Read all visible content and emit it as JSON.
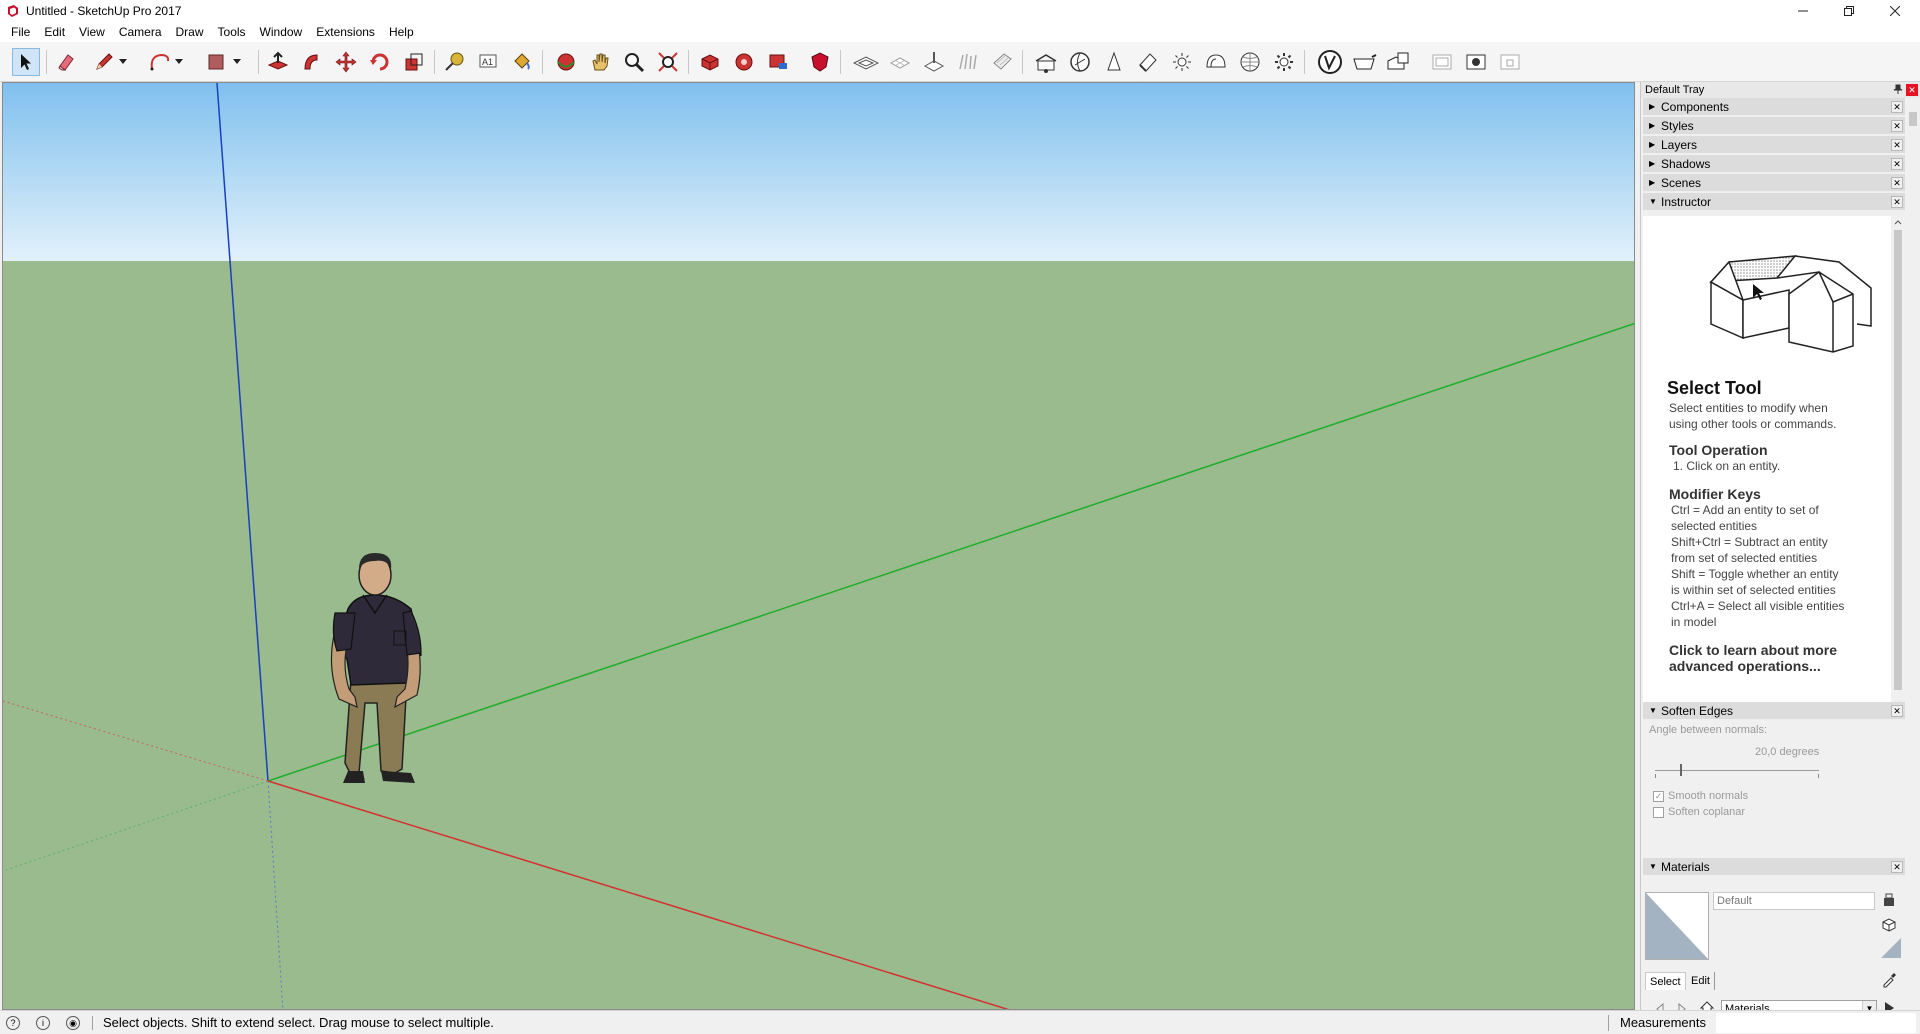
{
  "window": {
    "title": "Untitled - SketchUp Pro 2017"
  },
  "menu": [
    "File",
    "Edit",
    "View",
    "Camera",
    "Draw",
    "Tools",
    "Window",
    "Extensions",
    "Help"
  ],
  "toolbar": {
    "icons": [
      "select-tool-icon",
      "eraser-icon",
      "line-pencil-icon",
      "line-dropdown-icon",
      "arc-icon",
      "arc-dropdown-icon",
      "rectangle-icon",
      "rectangle-dropdown-icon",
      "push-pull-icon",
      "follow-me-icon",
      "move-icon",
      "rotate-icon",
      "scale-icon",
      "tape-measure-icon",
      "text-icon",
      "paint-bucket-icon",
      "orbit-icon",
      "pan-icon",
      "zoom-icon",
      "zoom-extents-icon",
      "3d-warehouse-icon",
      "extension-warehouse-icon",
      "send-to-layout-icon",
      "extension-manager-icon",
      "sandbox-from-contours-icon",
      "sandbox-from-scratch-icon",
      "smoove-icon",
      "stamp-icon",
      "drape-icon",
      "add-detail-icon",
      "flip-edge-icon",
      "xray-icon",
      "back-edges-icon",
      "wireframe-icon",
      "hidden-line-icon",
      "shaded-icon",
      "shaded-textures-icon",
      "monochrome-icon",
      "iso-view-icon",
      "top-view-icon",
      "front-view-icon",
      "right-view-icon",
      "back-view-icon",
      "left-view-icon"
    ]
  },
  "tray": {
    "title": "Default Tray",
    "panels": [
      {
        "label": "Components",
        "expanded": false
      },
      {
        "label": "Styles",
        "expanded": false
      },
      {
        "label": "Layers",
        "expanded": false
      },
      {
        "label": "Shadows",
        "expanded": false
      },
      {
        "label": "Scenes",
        "expanded": false
      },
      {
        "label": "Instructor",
        "expanded": true
      }
    ],
    "instructor": {
      "title": "Select Tool",
      "desc_1": "Select entities to modify when",
      "desc_2": "using other tools or commands.",
      "op_heading": "Tool Operation",
      "op_1": "1. Click on an entity.",
      "mod_heading": "Modifier Keys",
      "mod_lines": [
        "Ctrl = Add an entity to set of",
        "selected entities",
        "Shift+Ctrl = Subtract an entity",
        "from set of selected entities",
        "Shift = Toggle whether an entity",
        "is within set of selected entities",
        "Ctrl+A = Select all visible entities",
        "in model"
      ],
      "link_1": "Click to learn about more",
      "link_2": "advanced operations..."
    },
    "soften_edges": {
      "label": "Soften Edges",
      "angle_label": "Angle between normals:",
      "angle_value": "20,0  degrees",
      "angle_fraction": 0.15,
      "smooth_normals": "Smooth normals",
      "smooth_checked": true,
      "soften_coplanar": "Soften coplanar",
      "coplanar_checked": false
    },
    "materials": {
      "label": "Materials",
      "current": "Default",
      "tab_select": "Select",
      "tab_edit": "Edit",
      "library": "Materials"
    }
  },
  "status": {
    "text": "Select objects. Shift to extend select. Drag mouse to select multiple.",
    "measurements_label": "Measurements",
    "measurements_value": ""
  },
  "colors": {
    "sky_top": "#80c0ee",
    "sky_bottom": "#e2f1fb",
    "ground": "#99bb8d",
    "axis_red": "#d23232",
    "axis_green": "#1fae2a",
    "axis_blue": "#1a3fbf"
  }
}
